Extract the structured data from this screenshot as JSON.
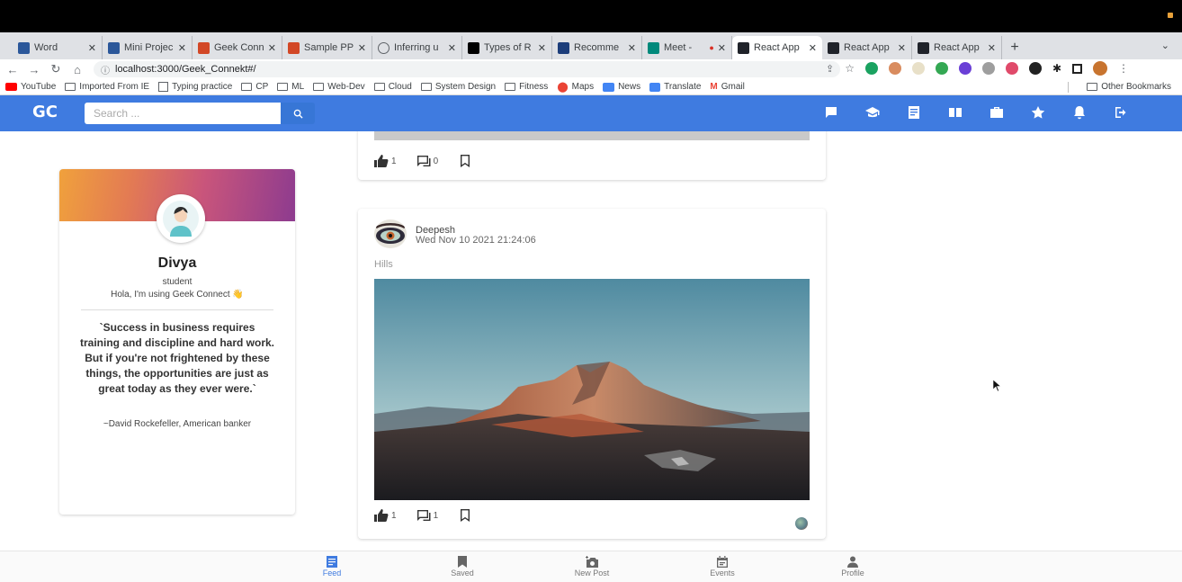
{
  "browser": {
    "tabs": [
      {
        "label": "Word",
        "favicon_color": "#2b579a",
        "active": false
      },
      {
        "label": "Mini Projec",
        "favicon_color": "#2b579a",
        "active": false
      },
      {
        "label": "Geek Conn",
        "favicon_color": "#d24726",
        "active": false
      },
      {
        "label": "Sample PP",
        "favicon_color": "#d24726",
        "active": false
      },
      {
        "label": "Inferring u",
        "favicon_color": "#5f6368",
        "active": false
      },
      {
        "label": "Types of R",
        "favicon_color": "#000000",
        "active": false
      },
      {
        "label": "Recomme",
        "favicon_color": "#1c3d7a",
        "active": false
      },
      {
        "label": "Meet -",
        "favicon_color": "#00897b",
        "active": false
      },
      {
        "label": "React App",
        "favicon_color": "#20232a",
        "active": true
      },
      {
        "label": "React App",
        "favicon_color": "#20232a",
        "active": false
      },
      {
        "label": "React App",
        "favicon_color": "#20232a",
        "active": false
      }
    ],
    "new_tab": "+",
    "tab_menu": "⌄",
    "url": "localhost:3000/Geek_Connekt#/",
    "bookmarks": [
      "YouTube",
      "Imported From IE",
      "Typing practice",
      "CP",
      "ML",
      "Web-Dev",
      "Cloud",
      "System Design",
      "Fitness",
      "Maps",
      "News",
      "Translate",
      "Gmail"
    ],
    "other_bookmarks": "Other Bookmarks"
  },
  "app": {
    "logo": "GC",
    "search_placeholder": "Search ...",
    "accent": "#3f7be0"
  },
  "previous_post": {
    "likes": "1",
    "comments": "0"
  },
  "profile": {
    "name": "Divya",
    "role": "student",
    "status": "Hola, I'm using Geek Connect 👋",
    "quote": "`Success in business requires training and discipline and hard work. But if you're not frightened by these things, the opportunities are just as great today as they ever were.`",
    "author": "~David Rockefeller, American banker"
  },
  "post": {
    "user": "Deepesh",
    "date": "Wed Nov 10 2021 21:24:06",
    "text": "Hills",
    "likes": "1",
    "comments": "1"
  },
  "bottom_nav": [
    {
      "label": "Feed",
      "icon": "feed-icon",
      "active": true
    },
    {
      "label": "Saved",
      "icon": "bookmark-icon",
      "active": false
    },
    {
      "label": "New Post",
      "icon": "camera-plus-icon",
      "active": false
    },
    {
      "label": "Events",
      "icon": "calendar-icon",
      "active": false
    },
    {
      "label": "Profile",
      "icon": "person-icon",
      "active": false
    }
  ]
}
